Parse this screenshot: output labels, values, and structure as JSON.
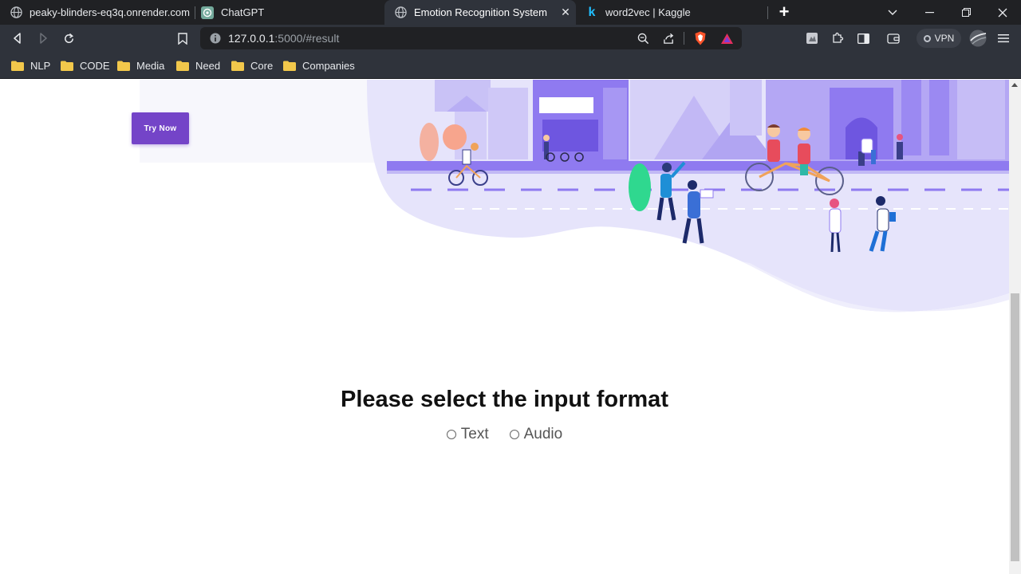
{
  "browser": {
    "tabs": [
      {
        "title": "peaky-blinders-eq3q.onrender.com",
        "icon": "globe-icon",
        "active": false
      },
      {
        "title": "ChatGPT",
        "icon": "chatgpt-icon",
        "active": false
      },
      {
        "title": "Emotion Recognition System",
        "icon": "globe-icon",
        "active": true
      },
      {
        "title": "word2vec | Kaggle",
        "icon": "kaggle-icon",
        "active": false
      }
    ],
    "url_host": "127.0.0.1",
    "url_rest": ":5000/#result",
    "vpn_label": "VPN",
    "bookmarks": [
      "NLP",
      "CODE",
      "Media",
      "Need",
      "Core",
      "Companies"
    ]
  },
  "page": {
    "try_button": "Try Now",
    "heading": "Please select the input format",
    "options": [
      "Text",
      "Audio"
    ]
  },
  "colors": {
    "accent": "#7444c8",
    "illustration_bg": "#e6e4fb",
    "illustration_buildings": "#8f7af0"
  }
}
